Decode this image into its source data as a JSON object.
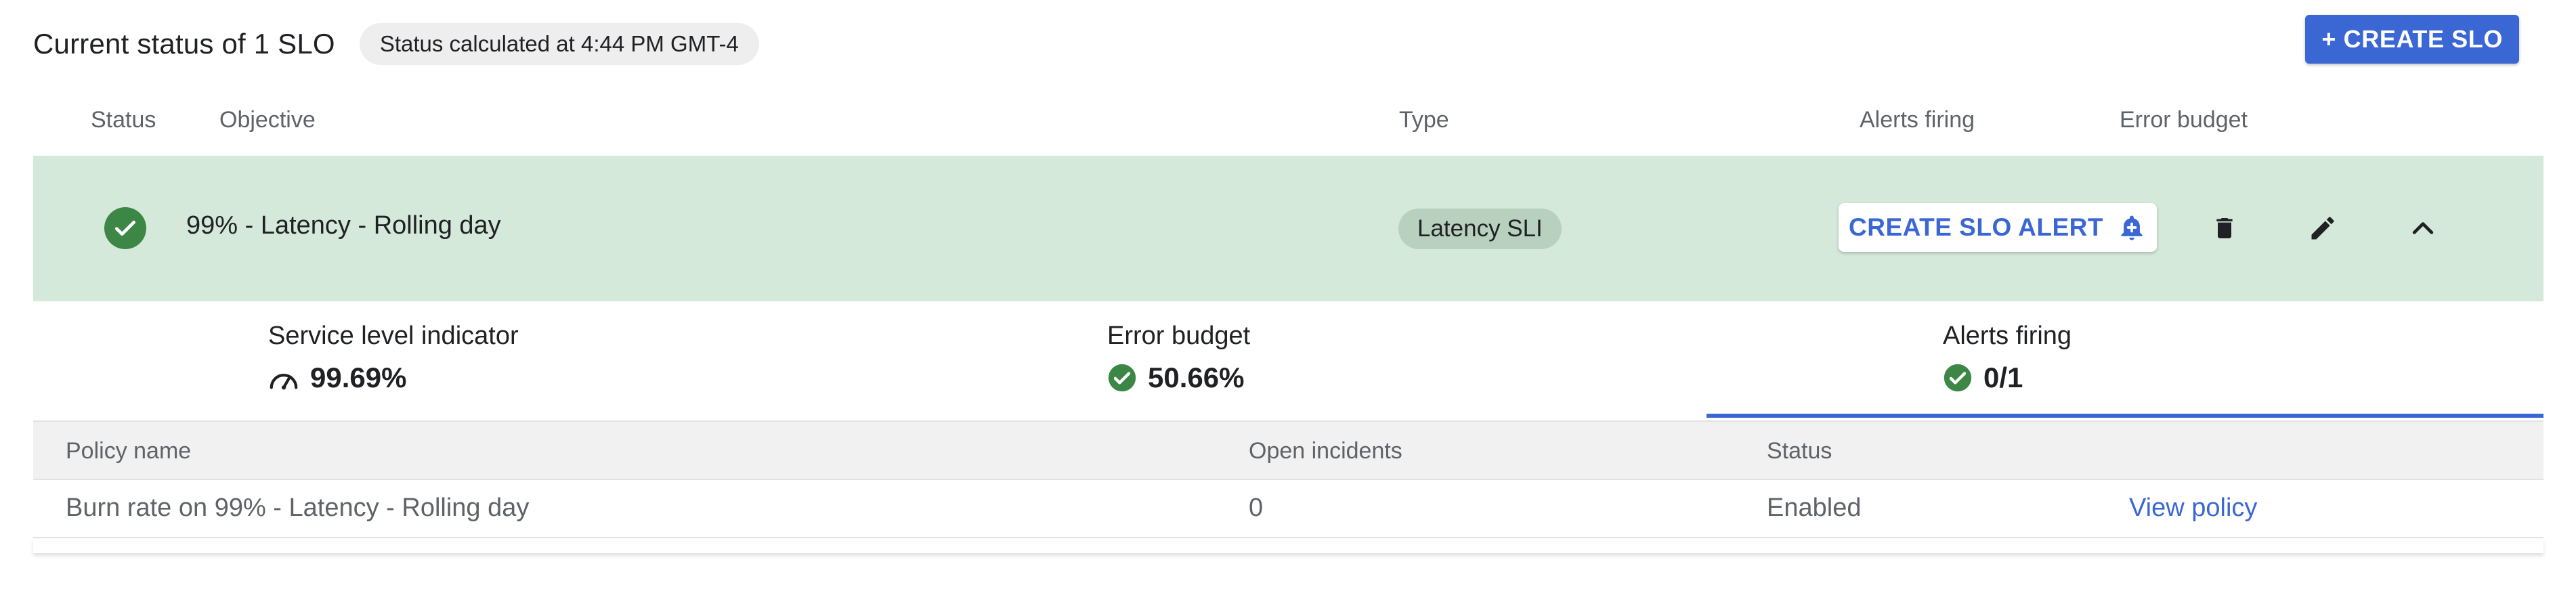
{
  "header": {
    "title": "Current status of 1 SLO",
    "status_chip": "Status calculated at 4:44 PM GMT-4",
    "create_slo_label": "+ CREATE SLO"
  },
  "columns": {
    "status": "Status",
    "objective": "Objective",
    "type": "Type",
    "alerts_firing": "Alerts firing",
    "error_budget": "Error budget"
  },
  "slo": {
    "objective": "99% - Latency - Rolling day",
    "type": "Latency SLI",
    "create_alert_label": "CREATE SLO ALERT",
    "status_icon": "check-circle-icon",
    "actions": [
      "delete-icon",
      "edit-icon",
      "chevron-up-icon"
    ]
  },
  "metrics": {
    "sli": {
      "label": "Service level indicator",
      "value": "99.69%",
      "icon": "gauge-icon"
    },
    "error_budget": {
      "label": "Error budget",
      "value": "50.66%",
      "icon": "check-circle-icon"
    },
    "alerts": {
      "label": "Alerts firing",
      "value": "0/1",
      "icon": "check-circle-icon",
      "selected": true
    }
  },
  "policy_table": {
    "headers": [
      "Policy name",
      "Open incidents",
      "Status"
    ],
    "rows": [
      {
        "name": "Burn rate on 99% - Latency - Rolling day",
        "open_incidents": "0",
        "status": "Enabled",
        "link": "View policy"
      }
    ]
  },
  "colors": {
    "accent": "#3b67d4",
    "row_bg": "#d4e9da",
    "success": "#3c8746"
  }
}
